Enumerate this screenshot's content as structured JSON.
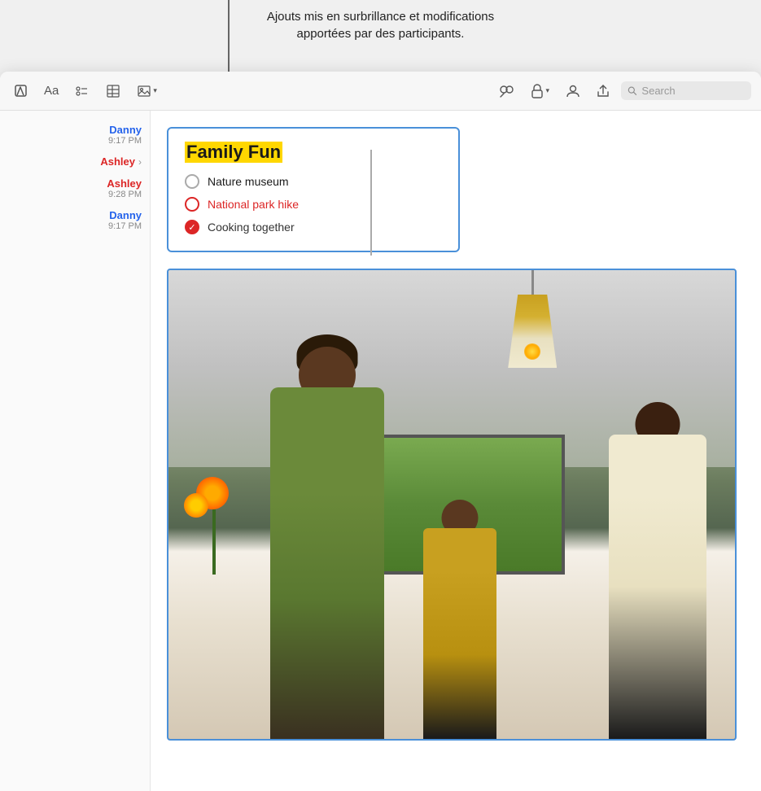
{
  "tooltip": {
    "line1": "Ajouts mis en surbrillance et modifications",
    "line2": "apportées par des participants."
  },
  "toolbar": {
    "font_btn": "Aa",
    "format_btn": "⊞",
    "table_btn": "⊟",
    "media_btn": "▣",
    "collab_icon": "☁",
    "lock_btn": "🔒",
    "share_btn": "⬆",
    "search_placeholder": "Search",
    "search_label": "Search",
    "edit_icon": "✎",
    "chevron": "▾"
  },
  "sidebar": {
    "changes": [
      {
        "author": "Danny",
        "time": "9:17 PM",
        "color": "danny",
        "has_arrow": false
      },
      {
        "author": "Ashley",
        "time": "",
        "color": "ashley",
        "has_arrow": true
      },
      {
        "author": "Ashley",
        "time": "9:28 PM",
        "color": "ashley",
        "has_arrow": false
      },
      {
        "author": "Danny",
        "time": "9:17 PM",
        "color": "danny",
        "has_arrow": false
      }
    ]
  },
  "document": {
    "title": "Family Fun",
    "checklist": [
      {
        "text": "Nature museum",
        "state": "empty"
      },
      {
        "text": "National park hike",
        "state": "circle-red"
      },
      {
        "text": "Cooking together",
        "state": "checked-red"
      }
    ]
  },
  "photo": {
    "alt": "Family cooking in kitchen"
  }
}
